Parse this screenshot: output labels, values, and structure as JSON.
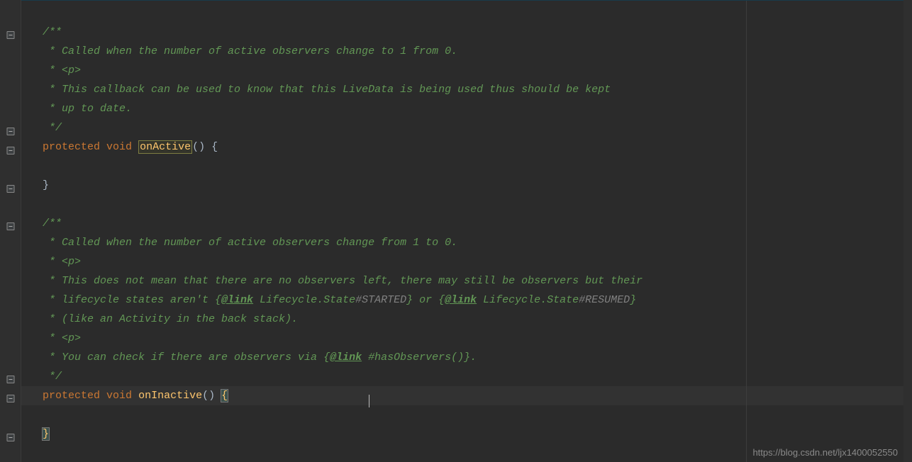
{
  "watermark": "https://blog.csdn.net/ljx1400052550",
  "kw": {
    "protected": "protected",
    "void": "void"
  },
  "method": {
    "onActive": "onActive",
    "onInactive": "onInactive"
  },
  "sym": {
    "parens": "()",
    "space": " ",
    "open": "{",
    "close": "}"
  },
  "doc1": {
    "open": "/**",
    "l1": " * Called when the number of active observers change to 1 from 0.",
    "l2": " * <p>",
    "l3": " * This callback can be used to know that this LiveData is being used thus should be kept",
    "l4": " * up to date.",
    "close": " */"
  },
  "doc2": {
    "open": "/**",
    "l1": " * Called when the number of active observers change from 1 to 0.",
    "l2": " * <p>",
    "l3": " * This does not mean that there are no observers left, there may still be observers but their",
    "l4_pre": " * lifecycle states aren't {",
    "l4_link1": "@link",
    "l4_mid1": " Lifecycle.State",
    "l4_tag1": "#STARTED",
    "l4_mid2": "} or {",
    "l4_link2": "@link",
    "l4_mid3": " Lifecycle.State",
    "l4_tag2": "#RESUMED",
    "l4_end": "}",
    "l5": " * (like an Activity in the back stack).",
    "l6": " * <p>",
    "l7_pre": " * You can check if there are observers via {",
    "l7_link": "@link",
    "l7_mid": " #hasObservers()",
    "l7_end": "}.",
    "close": " */"
  }
}
